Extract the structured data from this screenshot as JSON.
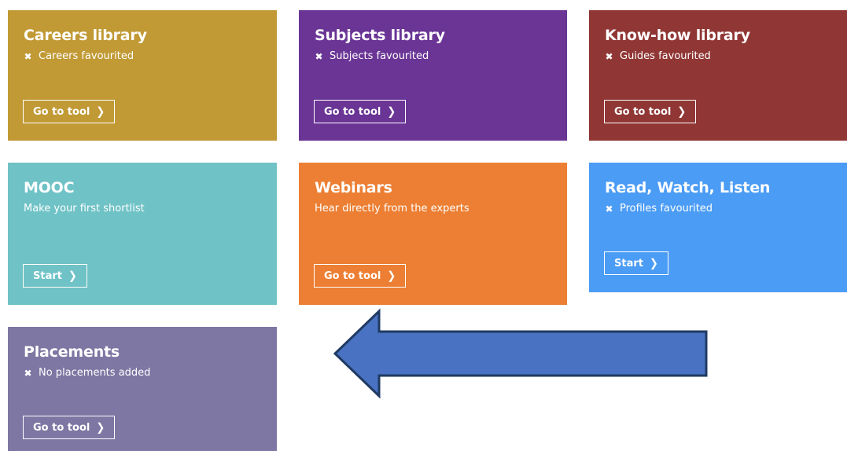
{
  "tiles": {
    "careers": {
      "title": "Careers library",
      "status": "Careers favourited",
      "button": "Go to tool",
      "color": "#c19a35"
    },
    "subjects": {
      "title": "Subjects library",
      "status": "Subjects favourited",
      "button": "Go to tool",
      "color": "#6a3595"
    },
    "knowhow": {
      "title": "Know-how library",
      "status": "Guides favourited",
      "button": "Go to tool",
      "color": "#903735"
    },
    "mooc": {
      "title": "MOOC",
      "status": "Make your first shortlist",
      "button": "Start",
      "color": "#6fc2c6"
    },
    "webinars": {
      "title": "Webinars",
      "status": "Hear directly from the experts",
      "button": "Go to tool",
      "color": "#ec7f33"
    },
    "rwl": {
      "title": "Read, Watch, Listen",
      "status": "Profiles favourited",
      "button": "Start",
      "color": "#4b9cf5"
    },
    "placements": {
      "title": "Placements",
      "status": "No placements added",
      "button": "Go to tool",
      "color": "#7e77a3"
    }
  },
  "icons": {
    "status_mark": "x-icon",
    "button_arrow": "chevron-right-icon"
  },
  "annotation_arrow": {
    "fill": "#4a72c2",
    "stroke": "#1f3a63"
  }
}
